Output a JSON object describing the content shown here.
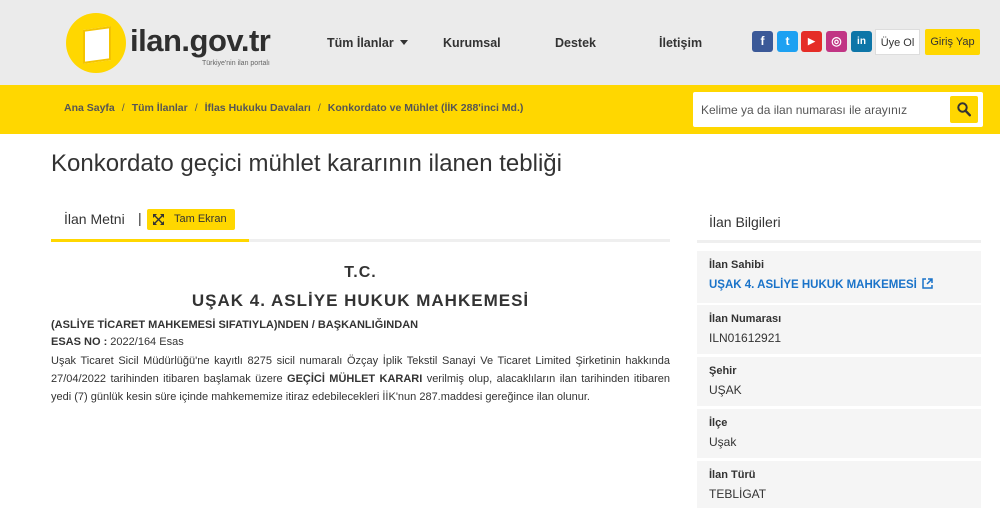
{
  "header": {
    "logo_text": "ilan.gov.tr",
    "logo_subtitle": "Türkiye'nin ilan portalı",
    "nav": [
      {
        "label": "Tüm İlanlar"
      },
      {
        "label": "Kurumsal"
      },
      {
        "label": "Destek"
      },
      {
        "label": "İletişim"
      }
    ],
    "social": [
      {
        "icon": "facebook-icon",
        "glyph": "f",
        "color": "#3b5998"
      },
      {
        "icon": "twitter-icon",
        "glyph": "t",
        "color": "#1da1f2"
      },
      {
        "icon": "youtube-icon",
        "glyph": "▶",
        "color": "#e52d27"
      },
      {
        "icon": "instagram-icon",
        "glyph": "◎",
        "color": "#c13584"
      },
      {
        "icon": "linkedin-icon",
        "glyph": "in",
        "color": "#0e76a8"
      }
    ],
    "register_label": "Üye Ol",
    "login_label": "Giriş Yap"
  },
  "breadcrumb": [
    "Ana Sayfa",
    "Tüm İlanlar",
    "İflas Hukuku Davaları",
    "Konkordato ve Mühlet (İİK 288'inci Md.)"
  ],
  "search": {
    "placeholder": "Kelime ya da ilan numarası ile arayınız"
  },
  "page_title": "Konkordato geçici mühlet kararının ilanen tebliği",
  "tabs": {
    "text_label": "İlan Metni",
    "separator": "|",
    "fullscreen_label": "Tam Ekran"
  },
  "document": {
    "tc": "T.C.",
    "court": "UŞAK 4. ASLİYE HUKUK MAHKEMESİ",
    "subtitle": "(ASLİYE TİCARET MAHKEMESİ SIFATIYLA)NDEN / BAŞKANLIĞINDAN",
    "esas_label": "ESAS NO :",
    "esas_value": "2022/164 Esas",
    "body_part1": "Uşak Ticaret Sicil Müdürlüğü'ne kayıtlı 8275 sicil numaralı Özçay İplik Tekstil Sanayi Ve Ticaret Limited Şirketinin hakkında 27/04/2022 tarihinden itibaren başlamak üzere ",
    "body_bold": "GEÇİCİ MÜHLET KARARI",
    "body_part2": " verilmiş olup, alacaklıların ilan tarihinden itibaren yedi (7) günlük kesin süre içinde mahkememize itiraz edebilecekleri İİK'nun 287.maddesi gereğince ilan olunur."
  },
  "sidebar": {
    "title": "İlan Bilgileri",
    "items": [
      {
        "label": "İlan Sahibi",
        "value": "UŞAK 4. ASLİYE HUKUK MAHKEMESİ"
      },
      {
        "label": "İlan Numarası",
        "value": "ILN01612921"
      },
      {
        "label": "Şehir",
        "value": "UŞAK"
      },
      {
        "label": "İlçe",
        "value": "Uşak"
      },
      {
        "label": "İlan Türü",
        "value": "TEBLİGAT"
      }
    ]
  }
}
